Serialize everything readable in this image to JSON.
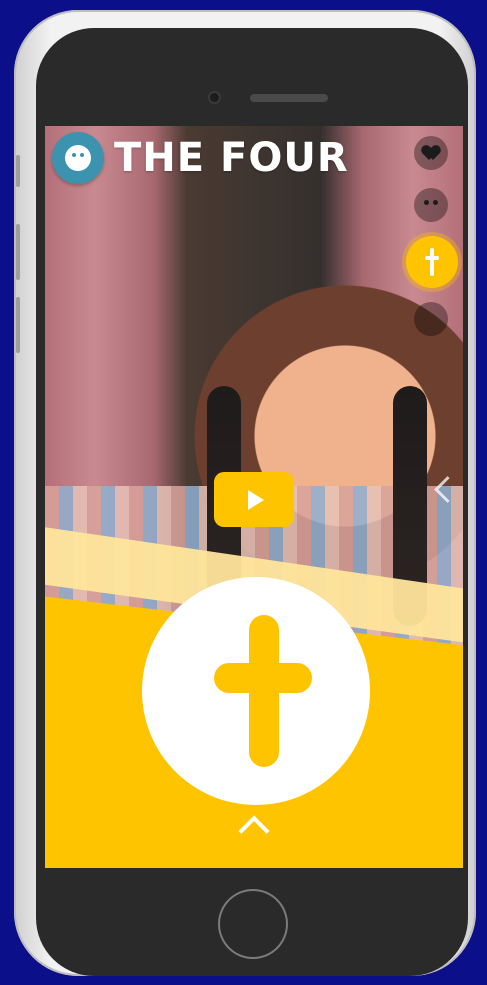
{
  "app": {
    "brand_text": "THE FOUR",
    "logo_icon": "smiley-icon",
    "play_icon": "play-icon",
    "big_icon": "cross-icon",
    "side_icons": [
      "heart-icon",
      "face-icon",
      "cross-icon",
      "unknown-icon"
    ],
    "accent_color": "#ffc400",
    "logo_color": "#3b93b0"
  }
}
